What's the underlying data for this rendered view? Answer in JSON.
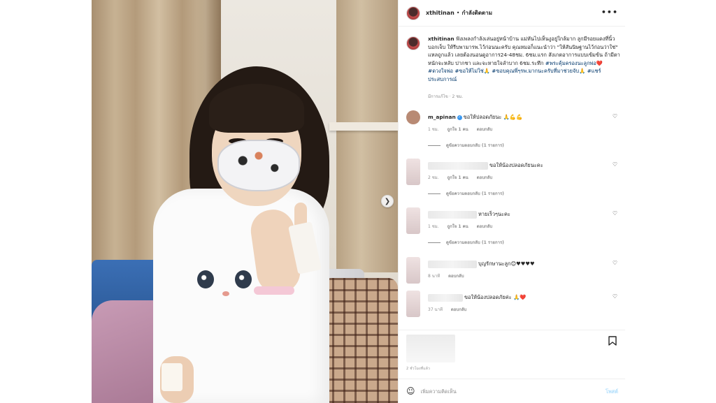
{
  "post": {
    "author": "xthitinan",
    "separator": "•",
    "follow_status": "กำลังติดตาม",
    "more_icon": "more-horizontal-icon"
  },
  "caption": {
    "username": "xthitinan",
    "text": "ฟังเพลงกำลังเล่นอยู่หน้าบ้าน แม่หันไปเห็นงูอยู่ใกล้มาก ลูกมีรอยแดงที่นิ้วบอกเจ็บ ให้รีบพามารพ.ไว้ก่อนนะครับ คุณหมอก็แนะนำว่า \"ให้สันนิษฐานไว้ก่อนว่าใช่\" แหลถูกแล้ว เลยต้องนอนดูอาการ24-48ชม. 6ชม.แรก สังเกตอาการแบบเข้มข้น ถ้ามีตาหนักจะหลับ ปากชา และจะหายใจลำบาก 6ชม.ระทึก ",
    "hashtags": "#พระคุ้มครองนะลูกพ่อ❤️ #ดวงใจพ่อ #ขอให้ไม่ใช่🙏 #ขอบคุณพี่ๆรพ.มากนะครับที่มาช่วยจับ🙏 #แชร์ประสบการณ์",
    "meta": "มีการแก้ไข · 2 ชม."
  },
  "comments": [
    {
      "username": "m_apinan",
      "verified": true,
      "text": "ขอให้ปลอดภัยนะ 🙏💪💪",
      "time": "1 ชม.",
      "likes": "ถูกใจ 1 คน",
      "reply": "ตอบกลับ",
      "replies": "ดูข้อความตอบกลับ (1 รายการ)"
    },
    {
      "username": "",
      "text": "ขอให้น้องปลอดภัยนะคะ",
      "time": "2 ชม.",
      "likes": "ถูกใจ 1 คน",
      "reply": "ตอบกลับ",
      "replies": "ดูข้อความตอบกลับ (1 รายการ)"
    },
    {
      "username": "",
      "text": "หายเร็วๆนะคะ",
      "time": "1 ชม.",
      "likes": "ถูกใจ 1 คน",
      "reply": "ตอบกลับ",
      "replies": "ดูข้อความตอบกลับ (1 รายการ)"
    },
    {
      "username": "",
      "text": "บุญรักษานะลูก😊♥♥♥♥",
      "time": "8 นาที",
      "reply": "ตอบกลับ"
    },
    {
      "username": "",
      "text": "ขอให้น้องปลอดภัยค่ะ 🙏❤️",
      "time": "37 นาที",
      "reply": "ตอบกลับ"
    }
  ],
  "footer": {
    "time_ago": "2 ชั่วโมงที่แล้ว",
    "comment_placeholder": "เพิ่มความคิดเห็น",
    "post_label": "โพสต์"
  },
  "colors": {
    "link": "#00376b",
    "muted": "#8e8e8e",
    "post_button_disabled": "#b2dffc"
  }
}
